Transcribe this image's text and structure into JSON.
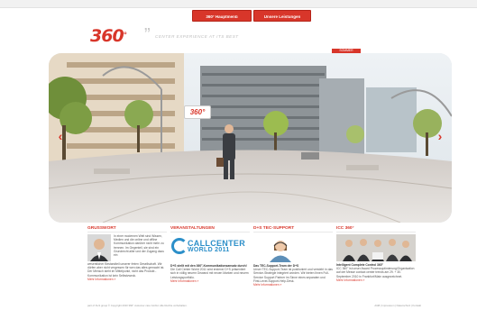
{
  "nav": {
    "item1": "360° Hauptmenü",
    "item2": "Unsere Leistungen"
  },
  "brand": {
    "logo": "360",
    "logo_sup": "°",
    "quote_mark": "”",
    "tagline": "CENTER EXPERIENCE AT ITS BEST",
    "accent": "#d8362a"
  },
  "hero": {
    "tag": "SOMMER",
    "badge": "360°",
    "prev": "‹",
    "next": "›"
  },
  "columns": {
    "grusswort": {
      "title": "GRUSSWORT",
      "text_top": "In einer modernen Welt sind Wissen, Medien und die online und offline Kommunikation darüber nicht mehr zu trennen. Im Gegenteil, sie sind ein Grundrecht aller und der Zugang dazu ein",
      "text_bottom": "wesentlicher Bestandteil unserer freien Gesellschaft. Wir dürfen aber nicht vergessen für wen das alles gemacht ist. Der Mensch steht im Mittelpunkt, nicht das Produkt - Kommunikation ist kein Selbstzweck.",
      "more": "Mehr Informationen »"
    },
    "veranstaltungen": {
      "title": "VERANSTALTUNGEN",
      "logo_line1": "CALLCENTER",
      "logo_line2": "WORLD 2011",
      "headline": "D+S  stellt mit den 360°-Kommunikationsansatz durch!",
      "text": "Die Call Center World 2011 wird erstens! D+S präsentiert sich in völlig neuem Gewand mit neuen Marken und neuem Leistungsportfolio.",
      "more": "Mehr Informationen »"
    },
    "tec_support": {
      "title": "D+S TEC-SUPPORT",
      "headline": "Das TEC-Support-Team der D+S",
      "text": "Unser TEC-Support-Team ist positioniert und versteht in das Service-Strategie integriert worden. Wir bieten Ihnen Full-Service Support Partner im Sinne eines separaten und First-Level-Support-Help-Desk.",
      "more": "Mehr Informationen »"
    },
    "icc360": {
      "title": "ICC 360°",
      "headline": "Intelligent Complete Control 360°",
      "text": "ICC 360° ist unser Award Prozessoptimierung/Organisation auf der Messe contact center trends am 29. + 30. September 2010 in Frankfurt/Main ausgezeichnet.",
      "more": "Mehr Informationen »"
    }
  },
  "footer": {
    "left": "part of D+S group  © Copyright 2010 360° customer care GmbH. Alle Rechte vorbehalten.",
    "right": "AGB  |  Impressum  |  Datenschutz  |  Kontakt"
  }
}
